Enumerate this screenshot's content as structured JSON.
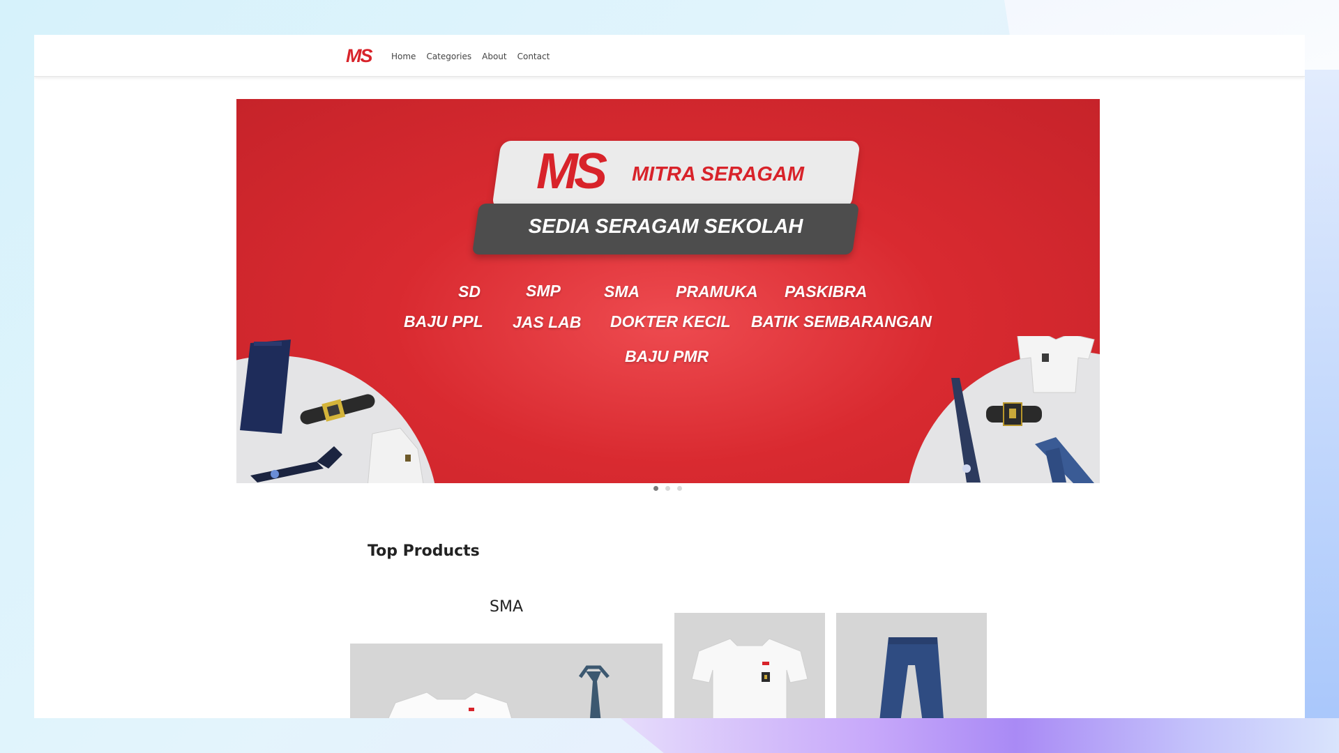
{
  "brand": {
    "logo_text": "MS",
    "accent": "#d8232a"
  },
  "nav": {
    "items": [
      "Home",
      "Categories",
      "About",
      "Contact"
    ]
  },
  "hero": {
    "logo_mark": "MS",
    "logo_name": "MITRA SERAGAM",
    "tagline": "SEDIA SERAGAM SEKOLAH",
    "row1": [
      "SD",
      "SMP",
      "SMA",
      "PRAMUKA",
      "PASKIBRA"
    ],
    "row2": [
      "BAJU PPL",
      "JAS LAB",
      "DOKTER KECIL",
      "BATIK SEMBARANGAN"
    ],
    "row3": [
      "BAJU PMR"
    ],
    "background": "#d92a30"
  },
  "carousel": {
    "slide_count": 3,
    "active_index": 0
  },
  "products": {
    "section_title": "Top Products",
    "featured_title": "SMA"
  }
}
